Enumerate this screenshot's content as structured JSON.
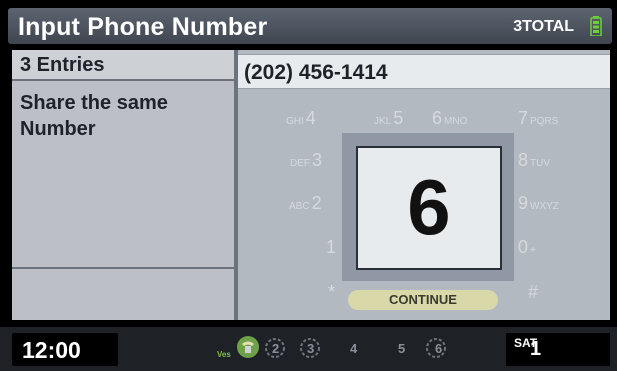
{
  "header": {
    "title": "Input Phone Number",
    "total_count": "3",
    "total_label": "TOTAL",
    "battery_icon": "battery-icon"
  },
  "left_panel": {
    "entries": "3 Entries",
    "message": "Share the same Number"
  },
  "phone_number": "(202) 456-1414",
  "keypad": {
    "left_col": [
      {
        "letters": "GHI",
        "digit": "4"
      },
      {
        "letters": "DEF",
        "digit": "3"
      },
      {
        "letters": "ABC",
        "digit": "2"
      },
      {
        "letters": "",
        "digit": "1"
      },
      {
        "letters": "",
        "digit": "*"
      }
    ],
    "top_row": [
      {
        "letters": "JKL",
        "digit": "5"
      },
      {
        "letters": "MNO",
        "digit": "6"
      }
    ],
    "right_col": [
      {
        "letters": "PQRS",
        "digit": "7"
      },
      {
        "letters": "TUV",
        "digit": "8"
      },
      {
        "letters": "WXYZ",
        "digit": "9"
      },
      {
        "letters": "+",
        "digit": "0"
      },
      {
        "letters": "",
        "digit": "#"
      }
    ],
    "selected_digit": "6"
  },
  "continue_label": "CONTINUE",
  "status_bar": {
    "clock": "12:00",
    "ves": "Ves",
    "presets": [
      "2",
      "3",
      "4",
      "5",
      "6"
    ],
    "day": "SAT",
    "day_number": "1"
  },
  "colors": {
    "header_bg": "#4a525c",
    "panel_bg": "#bcc0c6",
    "highlight": "#e8ebee",
    "continue_bg": "#d9d8a8"
  }
}
